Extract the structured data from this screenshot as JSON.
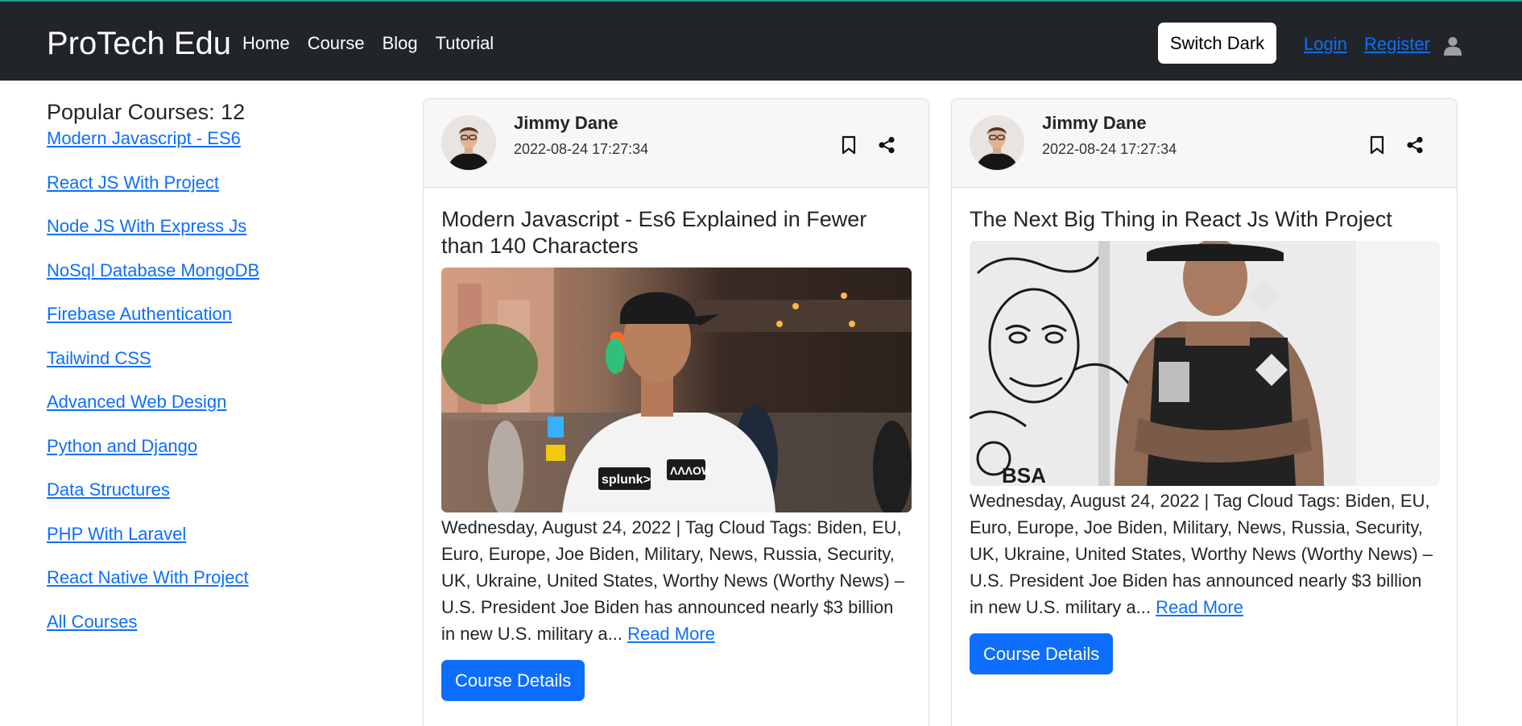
{
  "navbar": {
    "brand": "ProTech Edu",
    "links": [
      "Home",
      "Course",
      "Blog",
      "Tutorial"
    ],
    "switch_label": "Switch Dark",
    "login_label": "Login",
    "register_label": "Register",
    "user_icon": "user-icon",
    "colors": {
      "background": "#212529",
      "accent_top": "#2a9d8f",
      "link": "#0d6efd"
    }
  },
  "sidebar": {
    "title": "Popular Courses: 12",
    "courses": [
      "Modern Javascript - ES6",
      "React JS With Project",
      "Node JS With Express Js",
      "NoSql Database MongoDB",
      "Firebase Authentication",
      "Tailwind CSS",
      "Advanced Web Design",
      "Python and Django",
      "Data Structures",
      "PHP With Laravel",
      "React Native With Project",
      "All Courses"
    ]
  },
  "posts": [
    {
      "author": "Jimmy Dane",
      "date": "2022-08-24 17:27:34",
      "title": "Modern Javascript - Es6 Explained in Fewer than 140 Characters",
      "excerpt": "Wednesday, August 24, 2022 | Tag Cloud Tags: Biden, EU, Euro, Europe, Joe Biden, Military, News, Russia, Security, UK, Ukraine, United States, Worthy News (Worthy News) – U.S. President Joe Biden has announced nearly $3 billion in new U.S. military a...",
      "read_more": "Read More",
      "button": "Course Details",
      "icons": [
        "bookmark-icon",
        "share-icon"
      ],
      "image": {
        "sponsor_labels": [
          "splunk>",
          "ΛΛΛOW"
        ]
      }
    },
    {
      "author": "Jimmy Dane",
      "date": "2022-08-24 17:27:34",
      "title": "The Next Big Thing in React Js With Project",
      "excerpt": "Wednesday, August 24, 2022 | Tag Cloud Tags: Biden, EU, Euro, Europe, Joe Biden, Military, News, Russia, Security, UK, Ukraine, United States, Worthy News (Worthy News) – U.S. President Joe Biden has announced nearly $3 billion in new U.S. military a...",
      "read_more": "Read More",
      "button": "Course Details",
      "icons": [
        "bookmark-icon",
        "share-icon"
      ],
      "image": {
        "wall_text": "BSA"
      }
    }
  ]
}
